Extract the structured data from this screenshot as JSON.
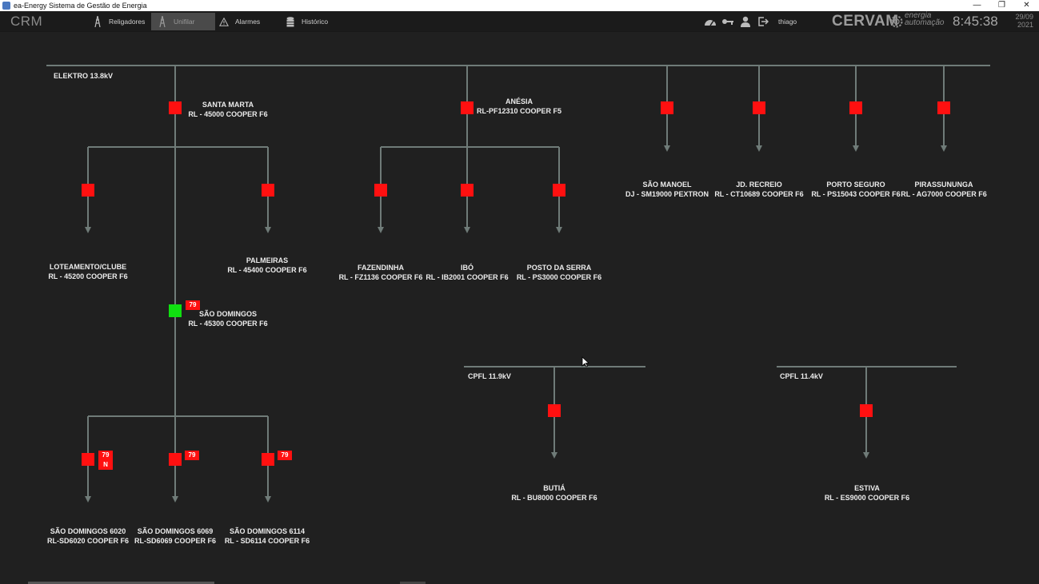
{
  "window": {
    "title": "ea-Energy Sistema de Gestão de Energia",
    "controls": [
      "—",
      "❐",
      "✕"
    ]
  },
  "appbar": {
    "brand": "CRM",
    "nav": [
      {
        "label": "Religadores",
        "icon": "tower-icon",
        "active": false
      },
      {
        "label": "Unifilar",
        "icon": "tower-icon",
        "active": true
      },
      {
        "label": "Alarmes",
        "icon": "warning-icon",
        "active": false
      },
      {
        "label": "Histórico",
        "icon": "database-icon",
        "active": false
      }
    ],
    "user": "thiago",
    "company": "CERVAM",
    "logo_text_1": "energia",
    "logo_text_2": "automação",
    "time": "8:45:38",
    "date_line1": "29/09",
    "date_line2": "2021"
  },
  "buses": [
    {
      "label": "ELEKTRO 13.8kV"
    },
    {
      "label": "CPFL 11.9kV"
    },
    {
      "label": "CPFL 11.4kV"
    }
  ],
  "feeders": [
    {
      "name": "SANTA MARTA",
      "device": "RL - 45000 COOPER F6",
      "state": "open"
    },
    {
      "name": "ANÉSIA",
      "device": "RL-PF12310 COOPER F5",
      "state": "open"
    },
    {
      "name": "SÃO MANOEL",
      "device": "DJ - SM19000  PEXTRON",
      "state": "open"
    },
    {
      "name": "JD. RECREIO",
      "device": "RL - CT10689 COOPER F6",
      "state": "open"
    },
    {
      "name": "PORTO SEGURO",
      "device": "RL - PS15043 COOPER F6",
      "state": "open"
    },
    {
      "name": "PIRASSUNUNGA",
      "device": "RL - AG7000 COOPER F6",
      "state": "open"
    },
    {
      "name": "LOTEAMENTO/CLUBE",
      "device": "RL - 45200 COOPER F6",
      "state": "open"
    },
    {
      "name": "PALMEIRAS",
      "device": "RL - 45400 COOPER F6",
      "state": "open"
    },
    {
      "name": "FAZENDINHA",
      "device": "RL - FZ1136 COOPER F6",
      "state": "open"
    },
    {
      "name": "IBÓ",
      "device": "RL - IB2001 COOPER F6",
      "state": "open"
    },
    {
      "name": "POSTO DA SERRA",
      "device": "RL - PS3000 COOPER F6",
      "state": "open"
    },
    {
      "name": "SÃO DOMINGOS",
      "device": "RL - 45300 COOPER F6",
      "state": "closed"
    },
    {
      "name": "SÃO DOMINGOS 6020",
      "device": "RL-SD6020 COOPER F6",
      "state": "open"
    },
    {
      "name": "SÃO DOMINGOS 6069",
      "device": "RL-SD6069 COOPER F6",
      "state": "open"
    },
    {
      "name": "SÃO DOMINGOS 6114",
      "device": "RL - SD6114 COOPER F6",
      "state": "open"
    },
    {
      "name": "BUTIÁ",
      "device": "RL - BU8000 COOPER F6",
      "state": "open"
    },
    {
      "name": "ESTIVA",
      "device": "RL - ES9000  COOPER F6",
      "state": "open"
    }
  ],
  "badges": {
    "reclose": "79",
    "neutral": "N"
  },
  "colors": {
    "open": "#ff1010",
    "closed": "#10e010",
    "line": "#6f7b78",
    "background": "#202020"
  }
}
